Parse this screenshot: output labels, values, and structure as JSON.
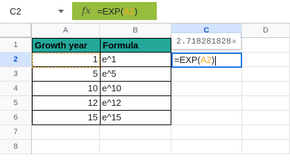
{
  "formula_bar": {
    "name_box": "C2",
    "fx_label": "fx",
    "formula_prefix": "=EXP(",
    "formula_ref": "A2",
    "formula_suffix": ")"
  },
  "columns": [
    "A",
    "B",
    "C",
    "D"
  ],
  "rows": [
    "1",
    "2",
    "3",
    "4",
    "5",
    "6",
    "7",
    "8"
  ],
  "table": {
    "headers": [
      "Growth year",
      "Formula"
    ],
    "data": [
      [
        "1",
        "e^1"
      ],
      [
        "5",
        "e^5"
      ],
      [
        "10",
        "e^10"
      ],
      [
        "12",
        "e^12"
      ],
      [
        "15",
        "e^15"
      ]
    ]
  },
  "active_cell": {
    "ref": "C2",
    "formula_prefix": "=EXP(",
    "formula_ref": "A2",
    "formula_suffix": ")"
  },
  "preview_tooltip": {
    "value": "2.718281828",
    "close": "×"
  },
  "colors": {
    "fx_background": "#97bd3e",
    "header_fill": "#23a89a",
    "reference_highlight": "#f5a623",
    "selection": "#1a73e8"
  }
}
